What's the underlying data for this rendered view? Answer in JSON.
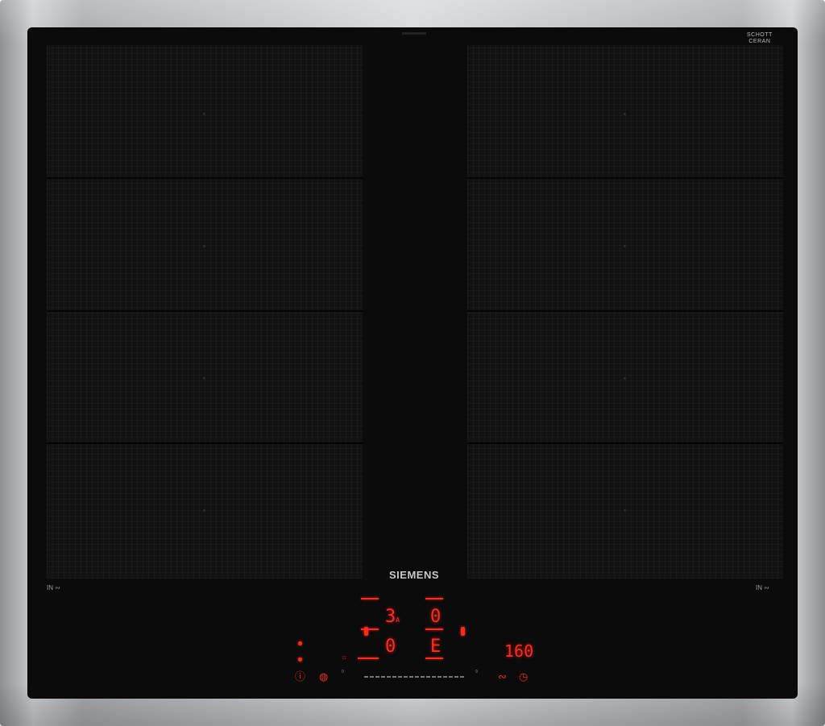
{
  "brand": {
    "logo_text": "SIEMENS"
  },
  "glass_maker": {
    "line1": "SCHOTT",
    "line2": "CERAN"
  },
  "left_zone": {
    "mode_label": "IN"
  },
  "right_zone": {
    "mode_label": "IN"
  },
  "controls": {
    "display_a": "3",
    "display_a_sub": "A",
    "display_b": "0",
    "display_c": "0",
    "display_d": "E",
    "timer": "160",
    "slider_min": "0",
    "slider_max": "9"
  },
  "colors": {
    "display": "#ff2b1e",
    "glass": "#0b0b0b",
    "frame": "#c9ccce"
  },
  "icons": [
    "info-icon",
    "child-lock-icon",
    "induction-icon",
    "timer-icon",
    "power-level-icon"
  ]
}
